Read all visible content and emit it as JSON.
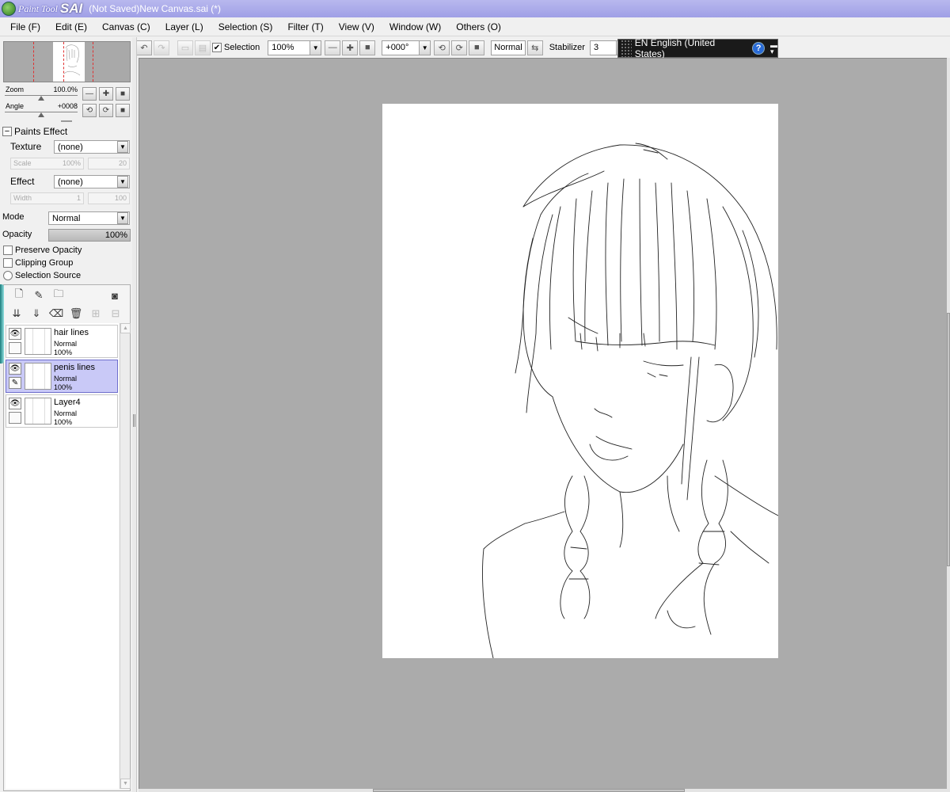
{
  "window": {
    "logo_paint": "Paint Tool",
    "logo_sai": "SAI",
    "title": "(Not Saved)New Canvas.sai (*)"
  },
  "menu": [
    "File (F)",
    "Edit (E)",
    "Canvas (C)",
    "Layer (L)",
    "Selection (S)",
    "Filter (T)",
    "View (V)",
    "Window (W)",
    "Others (O)"
  ],
  "toolbar": {
    "selection_label": "Selection",
    "selection_checked": true,
    "zoom_value": "100%",
    "angle_value": "+000°",
    "blend_mode": "Normal",
    "stabilizer_label": "Stabilizer",
    "stabilizer_value": "3"
  },
  "ime": {
    "language": "EN English (United States)",
    "help": "?"
  },
  "navigator": {
    "zoom_label": "Zoom",
    "zoom_value": "100.0%",
    "angle_label": "Angle",
    "angle_value": "+0008"
  },
  "paints_effect": {
    "header": "Paints Effect",
    "texture_label": "Texture",
    "texture_value": "(none)",
    "scale_label": "Scale",
    "scale_value": "100%",
    "scale_amount": "20",
    "effect_label": "Effect",
    "effect_value": "(none)",
    "width_label": "Width",
    "width_value": "1",
    "width_amount": "100"
  },
  "layer_props": {
    "mode_label": "Mode",
    "mode_value": "Normal",
    "opacity_label": "Opacity",
    "opacity_value": "100%",
    "preserve_opacity": "Preserve Opacity",
    "clipping_group": "Clipping Group",
    "selection_source": "Selection Source"
  },
  "layers": [
    {
      "name": "hair lines",
      "mode": "Normal",
      "opacity": "100%",
      "selected": false
    },
    {
      "name": "penis lines",
      "mode": "Normal",
      "opacity": "100%",
      "selected": true
    },
    {
      "name": "Layer4",
      "mode": "Normal",
      "opacity": "100%",
      "selected": false
    }
  ]
}
